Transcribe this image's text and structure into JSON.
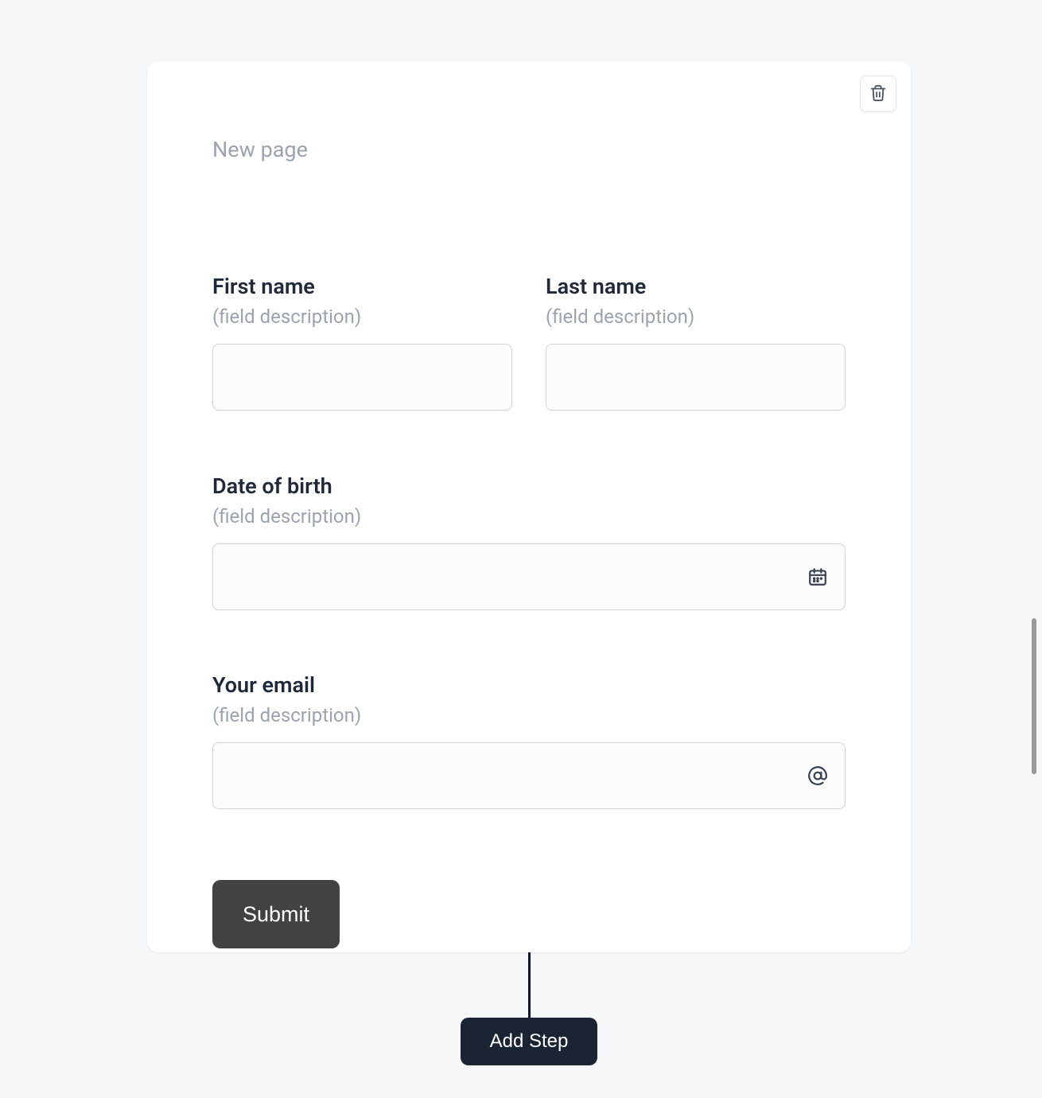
{
  "page": {
    "title_placeholder": "New page"
  },
  "fields": {
    "first_name": {
      "label": "First name",
      "desc": "(field description)"
    },
    "last_name": {
      "label": "Last name",
      "desc": "(field description)"
    },
    "dob": {
      "label": "Date of birth",
      "desc": "(field description)"
    },
    "email": {
      "label": "Your email",
      "desc": "(field description)"
    }
  },
  "buttons": {
    "submit": "Submit",
    "add_step": "Add Step"
  }
}
